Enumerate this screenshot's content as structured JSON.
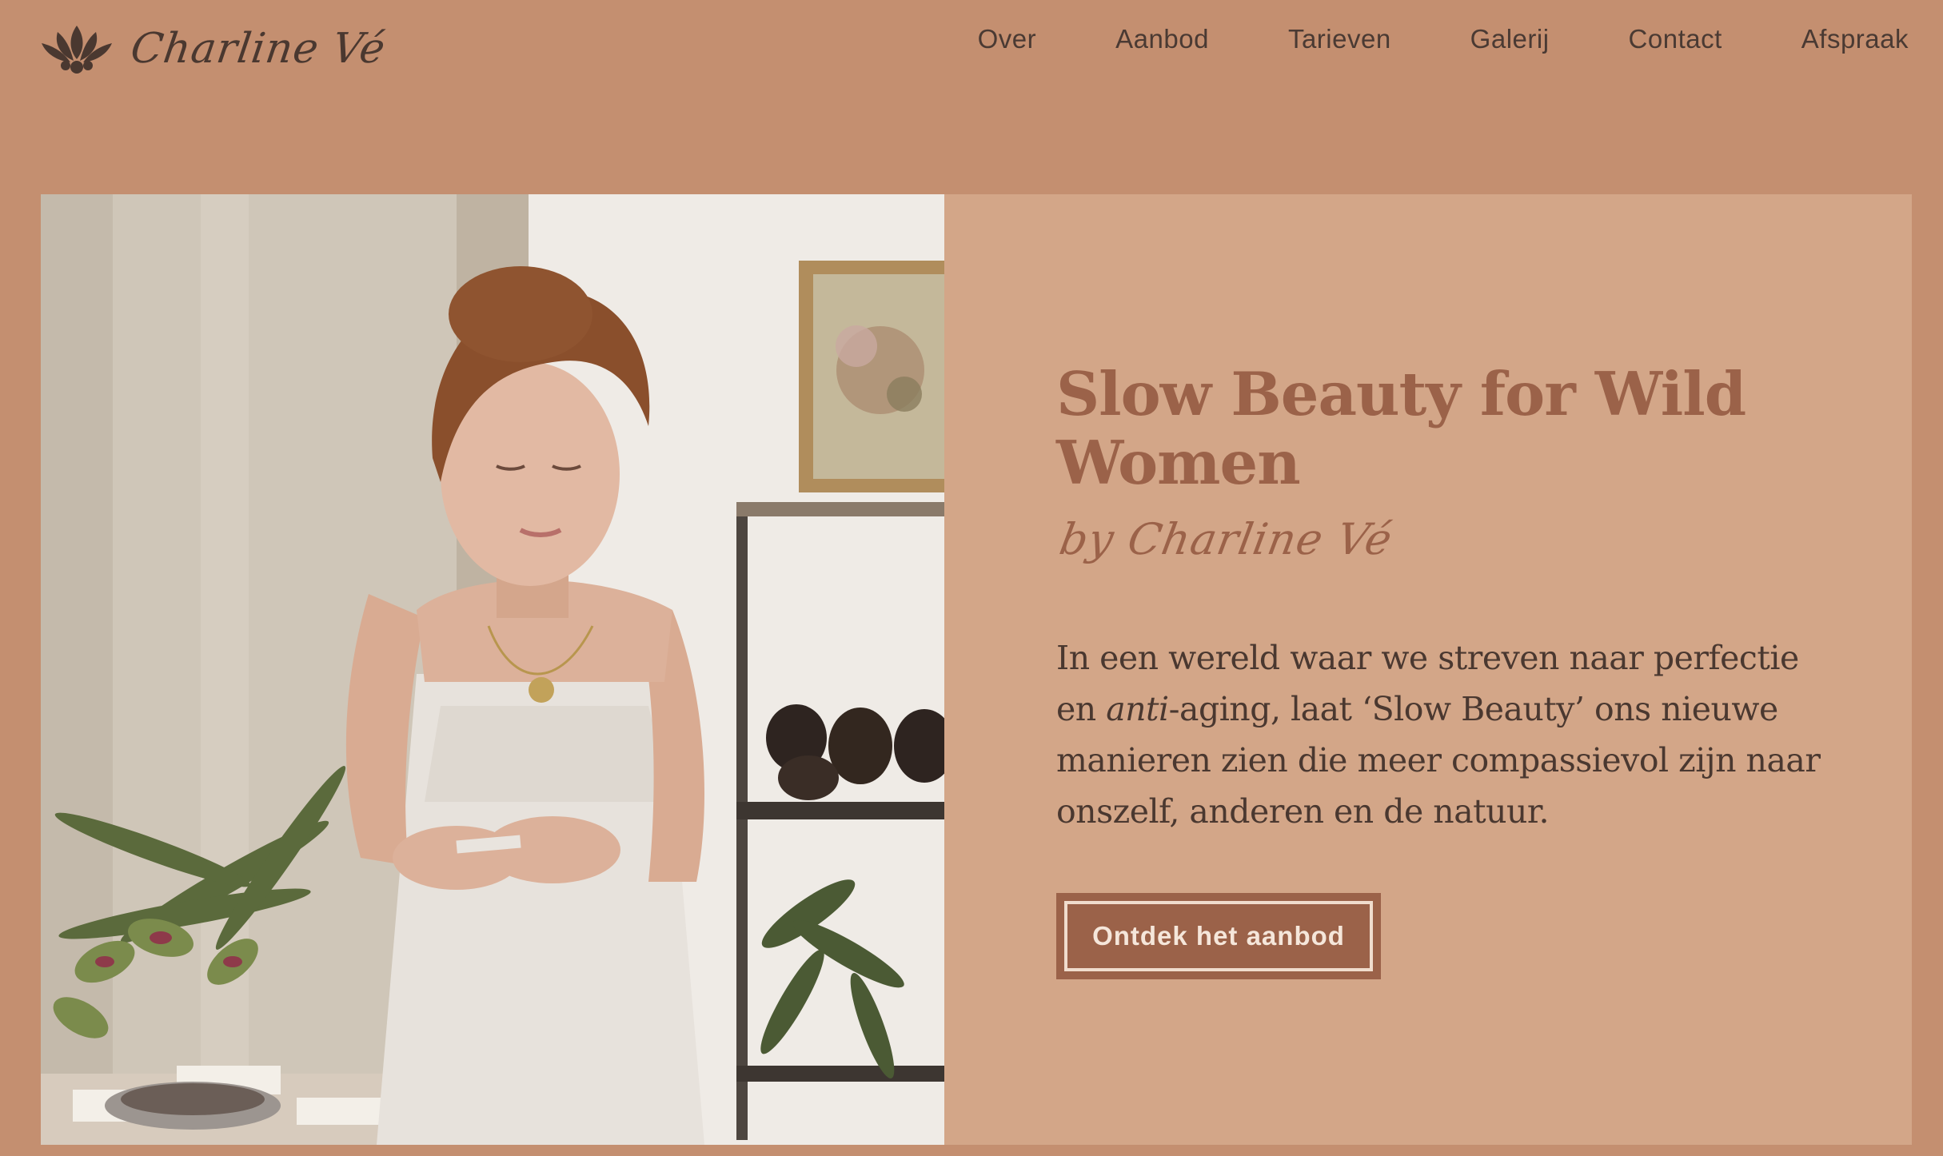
{
  "header": {
    "logo_text": "Charline Vé",
    "logo_icon": "lotus-icon",
    "nav": [
      {
        "label": "Over"
      },
      {
        "label": "Aanbod"
      },
      {
        "label": "Tarieven"
      },
      {
        "label": "Galerij"
      },
      {
        "label": "Contact"
      },
      {
        "label": "Afspraak"
      }
    ]
  },
  "hero": {
    "title": "Slow Beauty for Wild Women",
    "byline": "by Charline Vé",
    "body_em": "anti",
    "body_before": "In een wereld waar we streven naar perfectie en ",
    "body_after": "-aging, laat ‘Slow Beauty’ ons nieuwe manieren zien die meer compassievol zijn naar onszelf, anderen en de natuur.",
    "cta_label": "Ontdek het aanbod",
    "image": "woman-in-studio-photo"
  },
  "colors": {
    "background": "#c48f70",
    "panel": "#d3a688",
    "accent": "#9b6249",
    "text": "#4a3830"
  }
}
